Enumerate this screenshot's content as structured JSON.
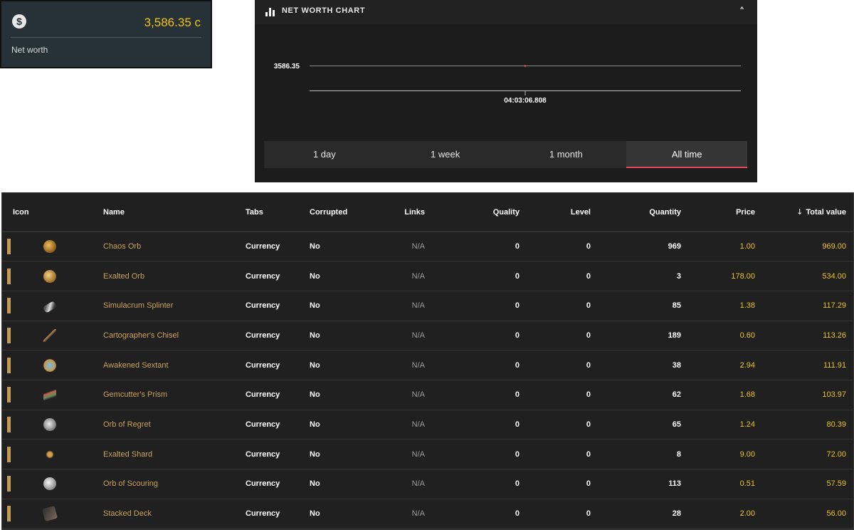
{
  "net_worth_card": {
    "icon": "dollar-coin-icon",
    "value": "3,586.35 c",
    "label": "Net worth"
  },
  "chart_panel": {
    "title": "NET WORTH CHART",
    "header_icon": "bar-chart-icon",
    "collapse_icon": "chevron-up-icon",
    "tabs": [
      {
        "label": "1 day",
        "active": false
      },
      {
        "label": "1 week",
        "active": false
      },
      {
        "label": "1 month",
        "active": false
      },
      {
        "label": "All time",
        "active": true
      }
    ]
  },
  "chart_data": {
    "type": "line",
    "series": [
      {
        "values": [
          3586.35
        ]
      }
    ],
    "x": [
      "04:03:06.808"
    ],
    "y_tick_labels": [
      "3586.35"
    ],
    "x_tick_labels": [
      "04:03:06.808"
    ],
    "colors": {
      "point": "#e8435a",
      "accent": "#e8435a"
    }
  },
  "table": {
    "columns": [
      {
        "key": "icon",
        "label": "Icon"
      },
      {
        "key": "name",
        "label": "Name"
      },
      {
        "key": "tabs",
        "label": "Tabs"
      },
      {
        "key": "corrupted",
        "label": "Corrupted"
      },
      {
        "key": "links",
        "label": "Links"
      },
      {
        "key": "quality",
        "label": "Quality"
      },
      {
        "key": "level",
        "label": "Level"
      },
      {
        "key": "quantity",
        "label": "Quantity"
      },
      {
        "key": "price",
        "label": "Price"
      },
      {
        "key": "total",
        "label": "Total value",
        "sort": "desc",
        "sort_icon": "arrow-down-icon"
      }
    ],
    "rows": [
      {
        "icon": "chaos-orb-icon",
        "name": "Chaos Orb",
        "tabs": "Currency",
        "corrupted": "No",
        "links": "N/A",
        "quality": "0",
        "level": "0",
        "quantity": "969",
        "price": "1.00",
        "total": "969.00"
      },
      {
        "icon": "exalted-orb-icon",
        "name": "Exalted Orb",
        "tabs": "Currency",
        "corrupted": "No",
        "links": "N/A",
        "quality": "0",
        "level": "0",
        "quantity": "3",
        "price": "178.00",
        "total": "534.00"
      },
      {
        "icon": "simulacrum-splinter-icon",
        "name": "Simulacrum Splinter",
        "tabs": "Currency",
        "corrupted": "No",
        "links": "N/A",
        "quality": "0",
        "level": "0",
        "quantity": "85",
        "price": "1.38",
        "total": "117.29"
      },
      {
        "icon": "cartographers-chisel-icon",
        "name": "Cartographer's Chisel",
        "tabs": "Currency",
        "corrupted": "No",
        "links": "N/A",
        "quality": "0",
        "level": "0",
        "quantity": "189",
        "price": "0.60",
        "total": "113.26"
      },
      {
        "icon": "awakened-sextant-icon",
        "name": "Awakened Sextant",
        "tabs": "Currency",
        "corrupted": "No",
        "links": "N/A",
        "quality": "0",
        "level": "0",
        "quantity": "38",
        "price": "2.94",
        "total": "111.91"
      },
      {
        "icon": "gemcutters-prism-icon",
        "name": "Gemcutter's Prism",
        "tabs": "Currency",
        "corrupted": "No",
        "links": "N/A",
        "quality": "0",
        "level": "0",
        "quantity": "62",
        "price": "1.68",
        "total": "103.97"
      },
      {
        "icon": "orb-of-regret-icon",
        "name": "Orb of Regret",
        "tabs": "Currency",
        "corrupted": "No",
        "links": "N/A",
        "quality": "0",
        "level": "0",
        "quantity": "65",
        "price": "1.24",
        "total": "80.39"
      },
      {
        "icon": "exalted-shard-icon",
        "name": "Exalted Shard",
        "tabs": "Currency",
        "corrupted": "No",
        "links": "N/A",
        "quality": "0",
        "level": "0",
        "quantity": "8",
        "price": "9.00",
        "total": "72.00"
      },
      {
        "icon": "orb-of-scouring-icon",
        "name": "Orb of Scouring",
        "tabs": "Currency",
        "corrupted": "No",
        "links": "N/A",
        "quality": "0",
        "level": "0",
        "quantity": "113",
        "price": "0.51",
        "total": "57.59"
      },
      {
        "icon": "stacked-deck-icon",
        "name": "Stacked Deck",
        "tabs": "Currency",
        "corrupted": "No",
        "links": "N/A",
        "quality": "0",
        "level": "0",
        "quantity": "28",
        "price": "2.00",
        "total": "56.00"
      }
    ]
  },
  "colors": {
    "gold_name": "#c8a15a",
    "price_yellow": "#e9c320",
    "net_worth_yellow": "#f1c40f",
    "row_bar": "#c59b55",
    "active_tab_underline": "#e8435a"
  }
}
